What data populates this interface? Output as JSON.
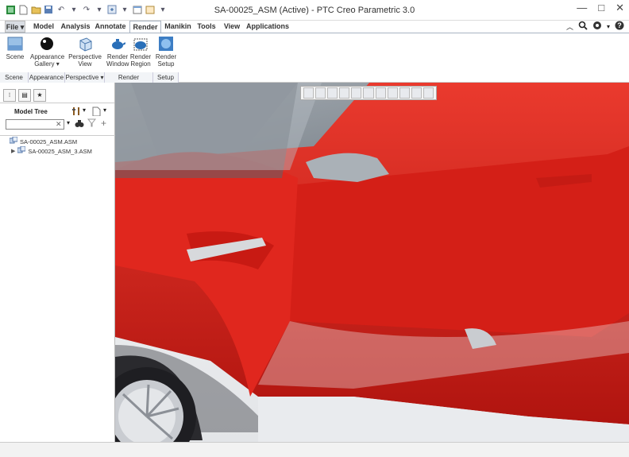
{
  "window": {
    "title": "SA-00025_ASM (Active) - PTC Creo Parametric 3.0",
    "min_label": "—",
    "max_label": "□",
    "close_label": "✕"
  },
  "tabs": [
    {
      "label": "File ▾"
    },
    {
      "label": "Model"
    },
    {
      "label": "Analysis"
    },
    {
      "label": "Annotate"
    },
    {
      "label": "Render"
    },
    {
      "label": "Manikin"
    },
    {
      "label": "Tools"
    },
    {
      "label": "View"
    },
    {
      "label": "Applications"
    }
  ],
  "ribbon": {
    "buttons": [
      {
        "line1": "Scene",
        "line2": ""
      },
      {
        "line1": "Appearance",
        "line2": "Gallery ▾"
      },
      {
        "line1": "Perspective",
        "line2": "View"
      },
      {
        "line1": "Render",
        "line2": "Window"
      },
      {
        "line1": "Render",
        "line2": "Region"
      },
      {
        "line1": "Render",
        "line2": "Setup"
      }
    ],
    "groups": [
      "Scene",
      "Appearance",
      "Perspective ▾",
      "Render",
      "Setup"
    ]
  },
  "panel": {
    "title": "Model Tree",
    "search_placeholder": "",
    "tree": [
      {
        "label": "SA-00025_ASM.ASM"
      },
      {
        "label": "SA-00025_ASM_3.ASM"
      }
    ]
  },
  "colors": {
    "accent": "#3c6fb0",
    "car_red": "#d6221a"
  }
}
